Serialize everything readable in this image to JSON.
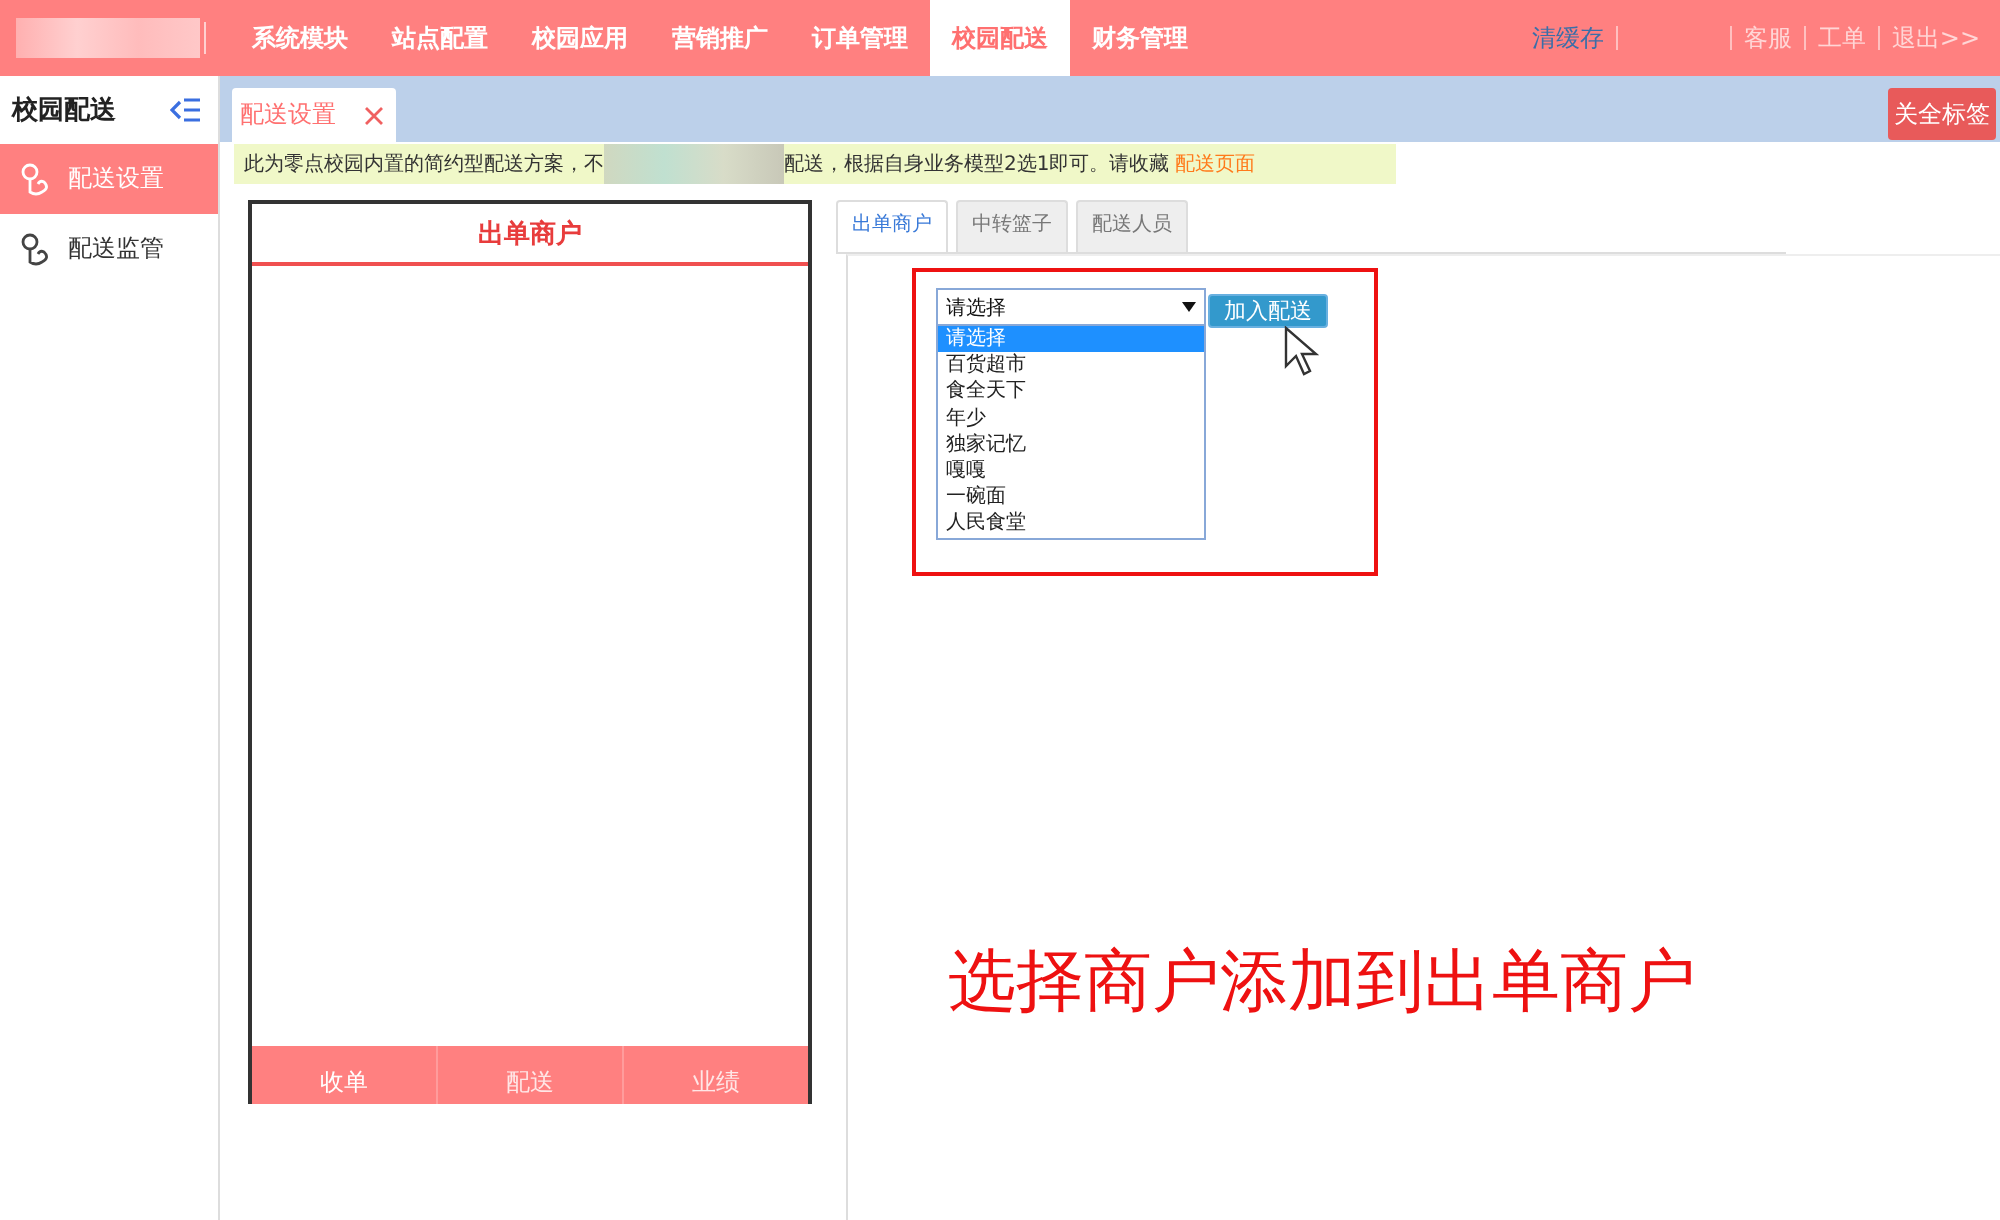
{
  "top_nav": {
    "items": [
      {
        "label": "系统模块",
        "selected": false
      },
      {
        "label": "站点配置",
        "selected": false
      },
      {
        "label": "校园应用",
        "selected": false
      },
      {
        "label": "营销推广",
        "selected": false
      },
      {
        "label": "订单管理",
        "selected": false
      },
      {
        "label": "校园配送",
        "selected": true
      },
      {
        "label": "财务管理",
        "selected": false
      }
    ],
    "links": [
      {
        "label": "清缓存",
        "kind": "highlight"
      },
      {
        "label": "客服",
        "kind": "plain"
      },
      {
        "label": "工单",
        "kind": "plain"
      },
      {
        "label": "退出>>",
        "kind": "plain"
      }
    ]
  },
  "sidebar": {
    "title": "校园配送",
    "items": [
      {
        "label": "配送设置",
        "selected": true
      },
      {
        "label": "配送监管",
        "selected": false
      }
    ]
  },
  "page_tabs": [
    {
      "label": "配送设置",
      "selected": true
    }
  ],
  "close_all_button": "关全标签",
  "notice": {
    "before": "此为零点校园内置的简约型配送方案，不",
    "after": "配送，根据自身业务模型2选1即可。请收藏",
    "link": "配送页面"
  },
  "merchant_panel": {
    "title": "出单商户",
    "footer": [
      {
        "label": "收单",
        "selected": true
      },
      {
        "label": "配送",
        "selected": false
      },
      {
        "label": "业绩",
        "selected": false
      }
    ]
  },
  "config_tabs": [
    {
      "label": "出单商户",
      "selected": true
    },
    {
      "label": "中转篮子",
      "selected": false
    },
    {
      "label": "配送人员",
      "selected": false
    }
  ],
  "merchant_select": {
    "value": "请选择",
    "expanded": true,
    "options": [
      {
        "label": "请选择",
        "selected": true
      },
      {
        "label": "百货超市",
        "selected": false
      },
      {
        "label": "食全天下",
        "selected": false
      },
      {
        "label": "年少",
        "selected": false
      },
      {
        "label": "独家记忆",
        "selected": false
      },
      {
        "label": "嘎嘎",
        "selected": false
      },
      {
        "label": "一碗面",
        "selected": false
      },
      {
        "label": "人民食堂",
        "selected": false
      }
    ]
  },
  "add_button": "加入配送",
  "annotation": "选择商户添加到出单商户"
}
